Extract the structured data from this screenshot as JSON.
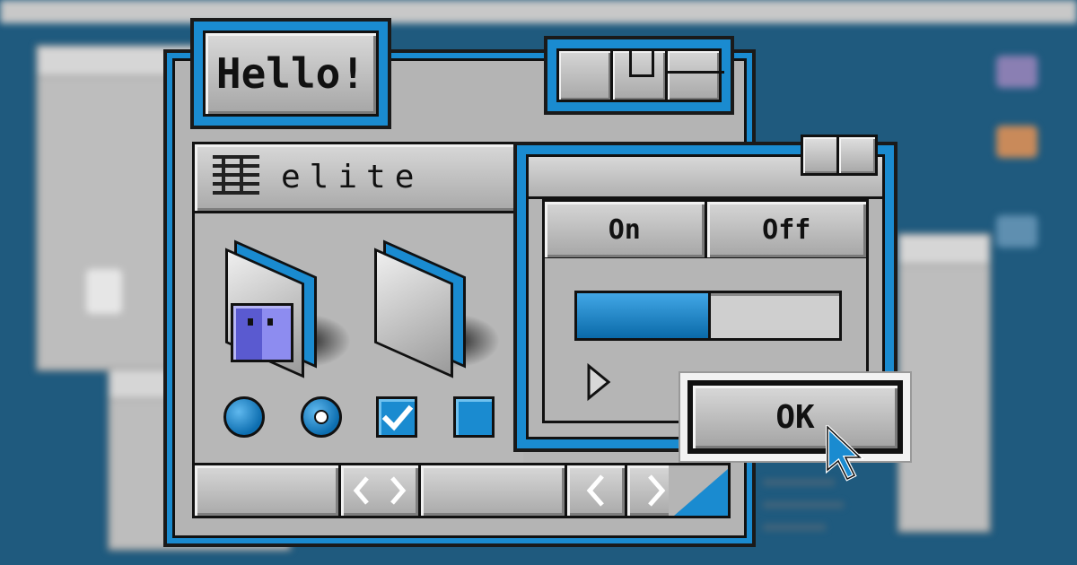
{
  "colors": {
    "accent": "#1a8bd0",
    "desktop": "#1f5a7e",
    "chrome": "#b4b4b4",
    "outline": "#111111"
  },
  "title_tab": {
    "label": "Hello!"
  },
  "list_panel": {
    "icon": "list-icon",
    "title": "elite"
  },
  "folders": [
    {
      "icon": "finder-folder-icon"
    },
    {
      "icon": "folder-icon"
    }
  ],
  "controls": {
    "radio_unselected": "radio-button",
    "radio_selected": "radio-button-selected",
    "checkbox_checked": "checkbox-checked",
    "checkbox_unchecked": "checkbox-unchecked"
  },
  "segmented": {
    "on_label": "On",
    "off_label": "Off"
  },
  "progress": {
    "value": 0.5
  },
  "ok_button": {
    "label": "OK"
  },
  "scrollbar": {
    "icons": [
      "horizontal-scroll-arrows-icon",
      "scroll-left-icon",
      "scroll-right-icon",
      "resize-corner-icon"
    ]
  }
}
